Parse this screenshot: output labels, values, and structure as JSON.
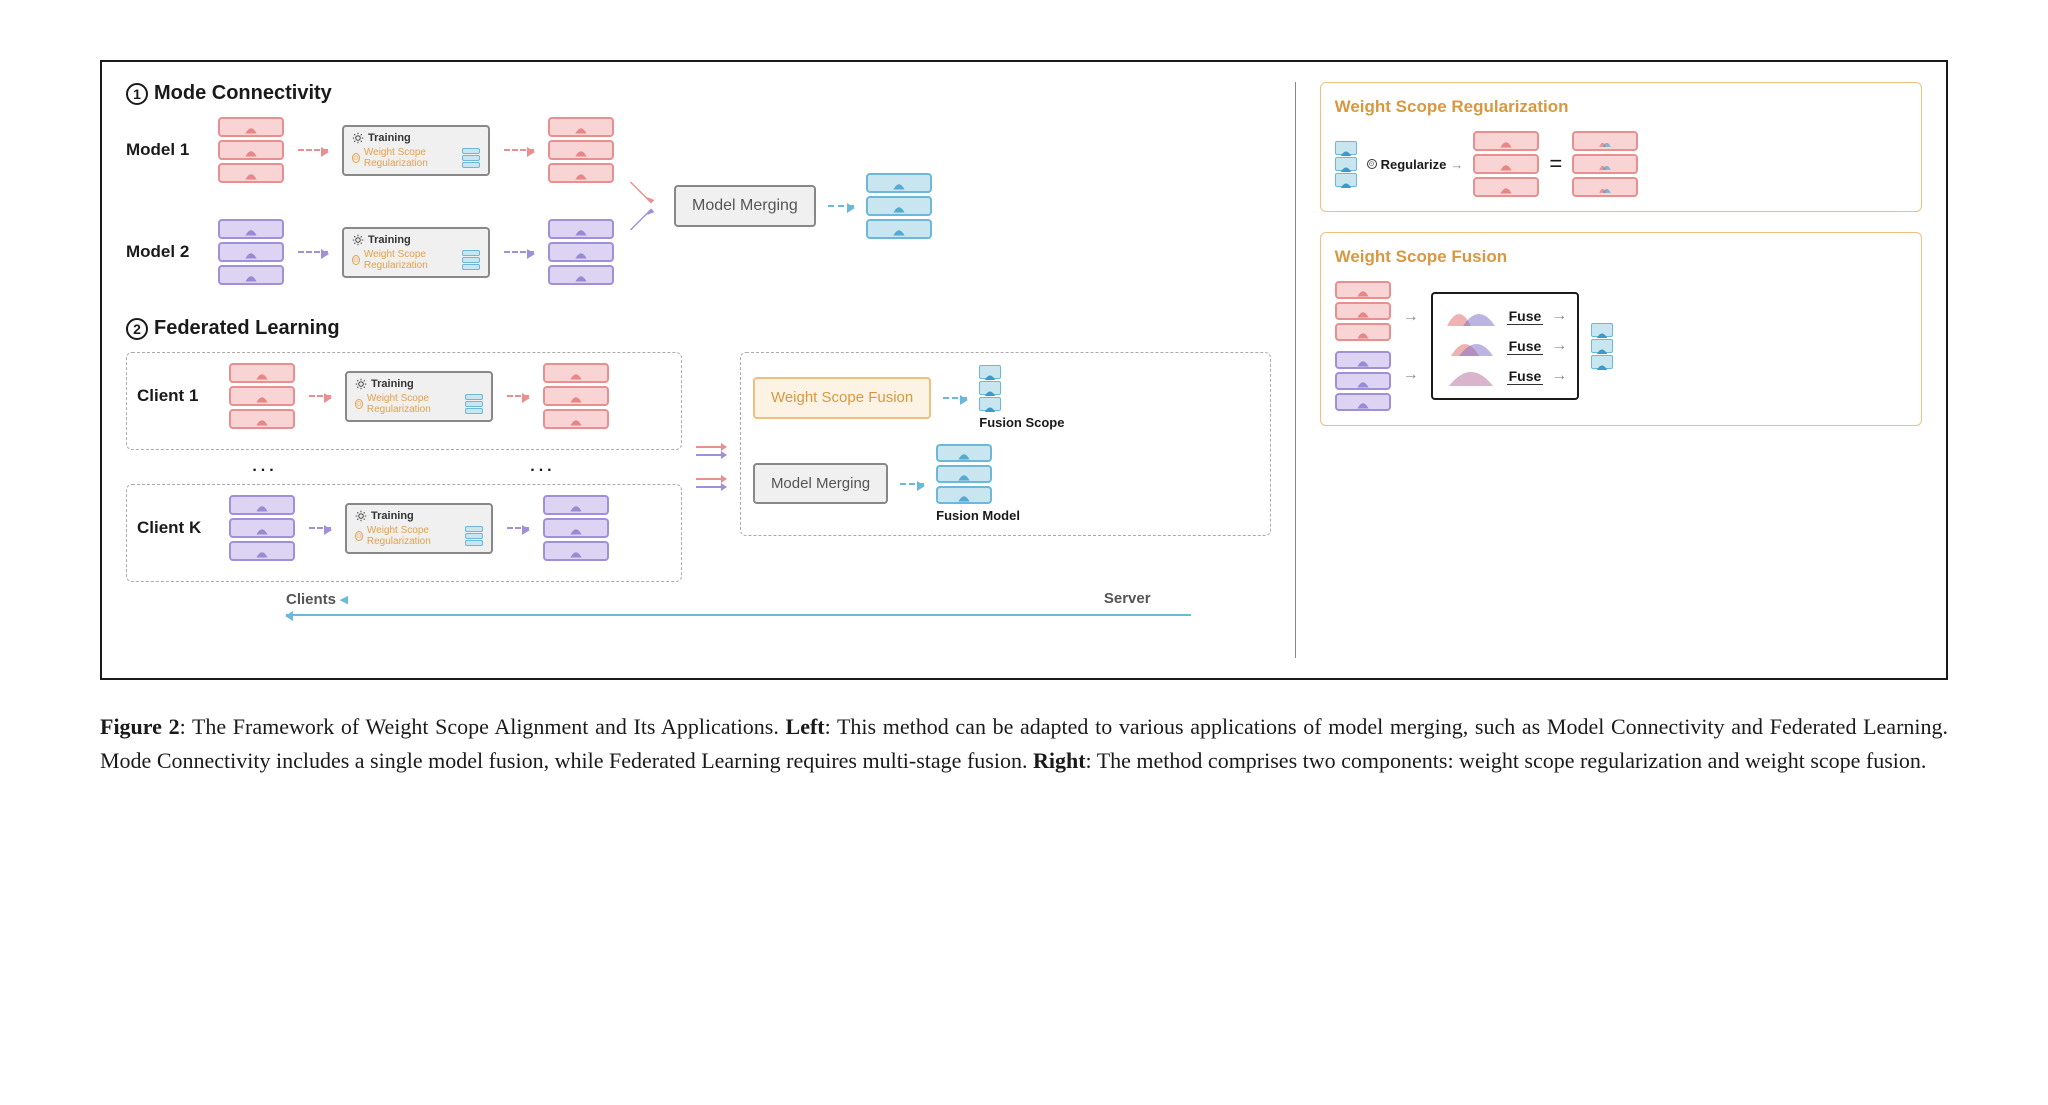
{
  "figure": {
    "number": "Figure 2",
    "caption_main": ": The Framework of Weight Scope Alignment and Its Applications. ",
    "caption_left_label": "Left",
    "caption_left": ": This method can be adapted to various applications of model merging, such as Model Connectivity and Federated Learning. Mode Connectivity includes a single model fusion, while Federated Learning requires multi-stage fusion. ",
    "caption_right_label": "Right",
    "caption_right": ": The method comprises two components: weight scope regularization and weight scope fusion."
  },
  "left": {
    "sec1_num": "1",
    "sec1_title": "Mode Connectivity",
    "model1": "Model 1",
    "model2": "Model 2",
    "training": "Training",
    "wsr": "Weight Scope Regularization",
    "merge": "Model Merging",
    "sec2_num": "2",
    "sec2_title": "Federated Learning",
    "client1": "Client 1",
    "clientk": "Client K",
    "dots": "...",
    "wsf": "Weight Scope Fusion",
    "fusion_scope": "Fusion Scope",
    "fusion_model": "Fusion Model",
    "clients": "Clients",
    "server": "Server"
  },
  "right": {
    "reg_title": "Weight Scope Regularization",
    "regularize": "Regularize",
    "fusion_title": "Weight Scope Fusion",
    "fuse": "Fuse"
  }
}
